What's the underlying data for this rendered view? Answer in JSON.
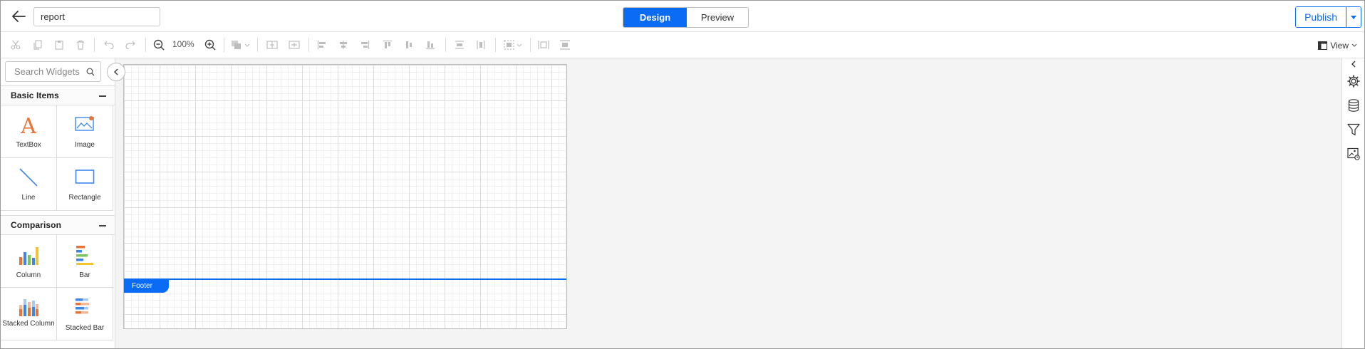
{
  "header": {
    "back_icon": "arrow-left-icon",
    "report_name": "report",
    "modes": {
      "design": "Design",
      "preview": "Preview"
    },
    "publish_label": "Publish",
    "accent_color": "#0a6cf5"
  },
  "toolbar": {
    "zoom_level": "100%",
    "view_label": "View",
    "icons": [
      "cut-icon",
      "copy-icon",
      "paste-icon",
      "delete-icon",
      "undo-icon",
      "redo-icon",
      "zoom-out-icon",
      "zoom-in-icon",
      "fill-color-icon",
      "align-grid-icon",
      "snap-icon",
      "align-left-icon",
      "align-center-icon",
      "align-right-icon",
      "align-top-icon",
      "align-middle-icon",
      "align-bottom-icon",
      "distribute-horizontal-icon",
      "distribute-vertical-icon",
      "grouping-icon",
      "size-same-width-icon",
      "size-same-height-icon",
      "view-layout-icon"
    ]
  },
  "left_panel": {
    "search_placeholder": "Search Widgets",
    "categories": [
      {
        "title": "Basic Items",
        "items": [
          {
            "label": "TextBox",
            "icon": "textbox-icon"
          },
          {
            "label": "Image",
            "icon": "image-icon"
          },
          {
            "label": "Line",
            "icon": "line-icon"
          },
          {
            "label": "Rectangle",
            "icon": "rectangle-icon"
          }
        ]
      },
      {
        "title": "Comparison",
        "items": [
          {
            "label": "Column",
            "icon": "column-chart-icon"
          },
          {
            "label": "Bar",
            "icon": "bar-chart-icon"
          },
          {
            "label": "Stacked Column",
            "icon": "stacked-column-icon"
          },
          {
            "label": "Stacked Bar",
            "icon": "stacked-bar-icon"
          }
        ]
      }
    ]
  },
  "canvas": {
    "footer_label": "Footer"
  },
  "right_rail": {
    "icons": [
      "collapse-right-icon",
      "settings-icon",
      "data-source-icon",
      "filter-icon",
      "image-manager-icon"
    ]
  }
}
